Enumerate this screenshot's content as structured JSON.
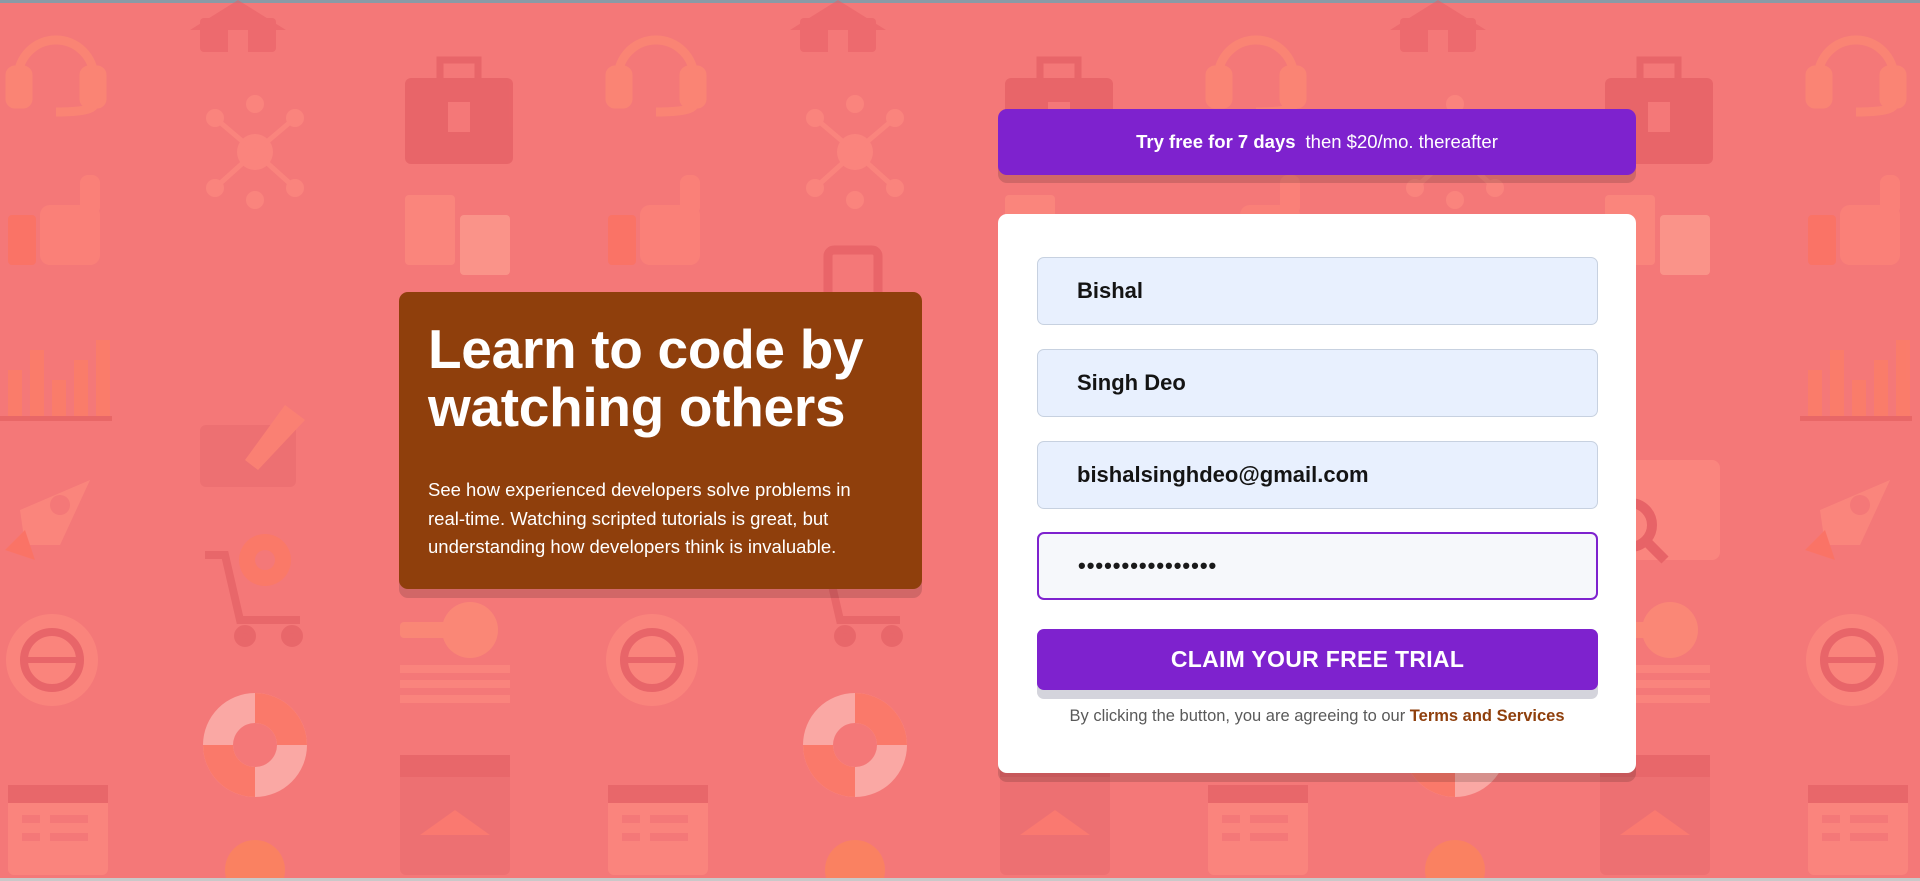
{
  "intro": {
    "title_line1": "Learn to code by",
    "title_line2": "watching others",
    "description": "See how experienced developers solve problems in real-time. Watching scripted tutorials is great, but understanding how developers think is invaluable."
  },
  "trial_banner": {
    "strong": "Try free for 7 days",
    "rest": "then $20/mo. thereafter"
  },
  "form": {
    "first_name": "Bishal",
    "last_name": "Singh Deo",
    "email": "bishalsinghdeo@gmail.com",
    "password_masked": "••••••••••••••••",
    "submit_label": "CLAIM YOUR FREE TRIAL",
    "terms_prefix": "By clicking the button, you are agreeing to our ",
    "terms_link": "Terms and Services"
  },
  "colors": {
    "background": "#f47878",
    "accent_purple": "#7e22ce",
    "brown": "#8f3f0c",
    "field_bg": "#e8f0fe"
  },
  "icons": [
    "home-icon",
    "headset-icon",
    "toolbox-icon",
    "network-icon",
    "thumbs-up-icon",
    "documents-icon",
    "chart-icon",
    "edit-icon",
    "rocket-icon",
    "cart-icon",
    "globe-gear-icon",
    "key-icon",
    "lifebuoy-icon",
    "calendar-icon",
    "browser-icon",
    "search-icon"
  ]
}
